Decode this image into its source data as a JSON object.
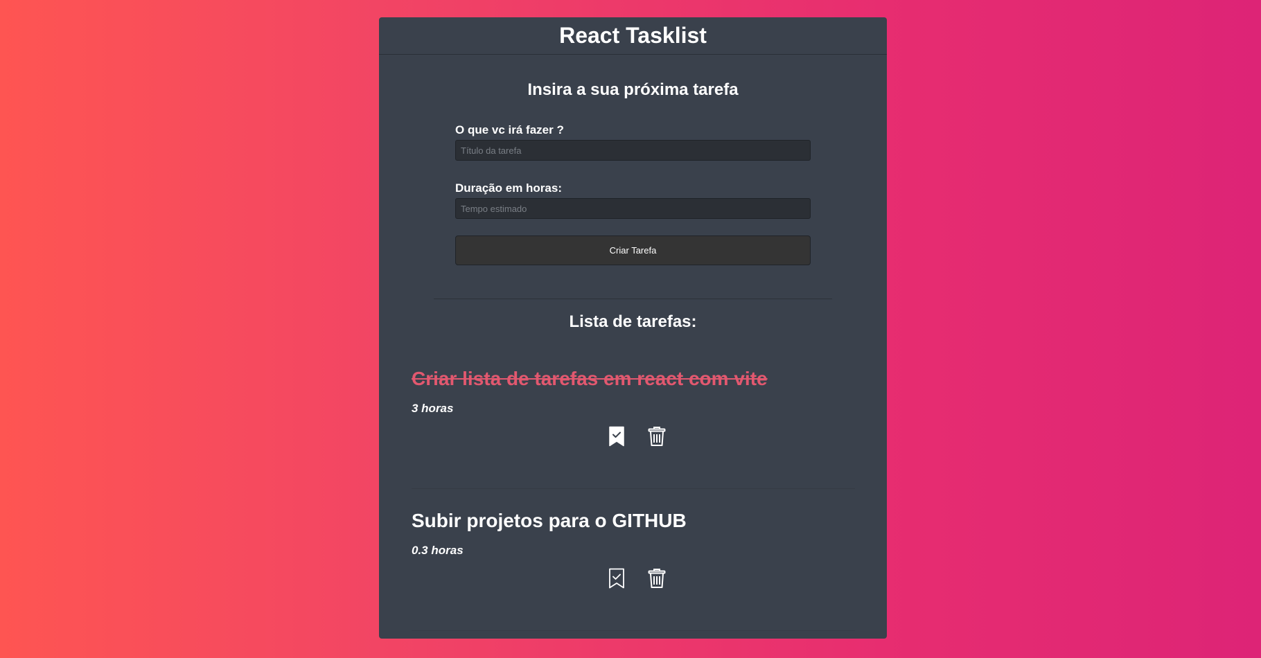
{
  "header": {
    "title": "React Tasklist"
  },
  "form": {
    "title": "Insira a sua próxima tarefa",
    "task_label": "O que vc irá fazer ?",
    "task_placeholder": "Título da tarefa",
    "task_value": "",
    "duration_label": "Duração em horas:",
    "duration_placeholder": "Tempo estimado",
    "duration_value": "",
    "submit_label": "Criar Tarefa"
  },
  "list": {
    "title": "Lista de tarefas:",
    "tasks": [
      {
        "title": "Criar lista de tarefas em react com vite",
        "hours": "3 horas",
        "done": true,
        "complete_icon": "bookmark-check-filled-icon",
        "delete_icon": "trash-icon"
      },
      {
        "title": "Subir projetos para o GITHUB",
        "hours": "0.3 horas",
        "done": false,
        "complete_icon": "bookmark-check-outline-icon",
        "delete_icon": "trash-icon"
      }
    ]
  },
  "colors": {
    "background_gradient_start": "#fe5552",
    "background_gradient_end": "#dd2476",
    "panel": "#3a414c",
    "done_task": "#e2586f",
    "text": "#ffffff"
  }
}
